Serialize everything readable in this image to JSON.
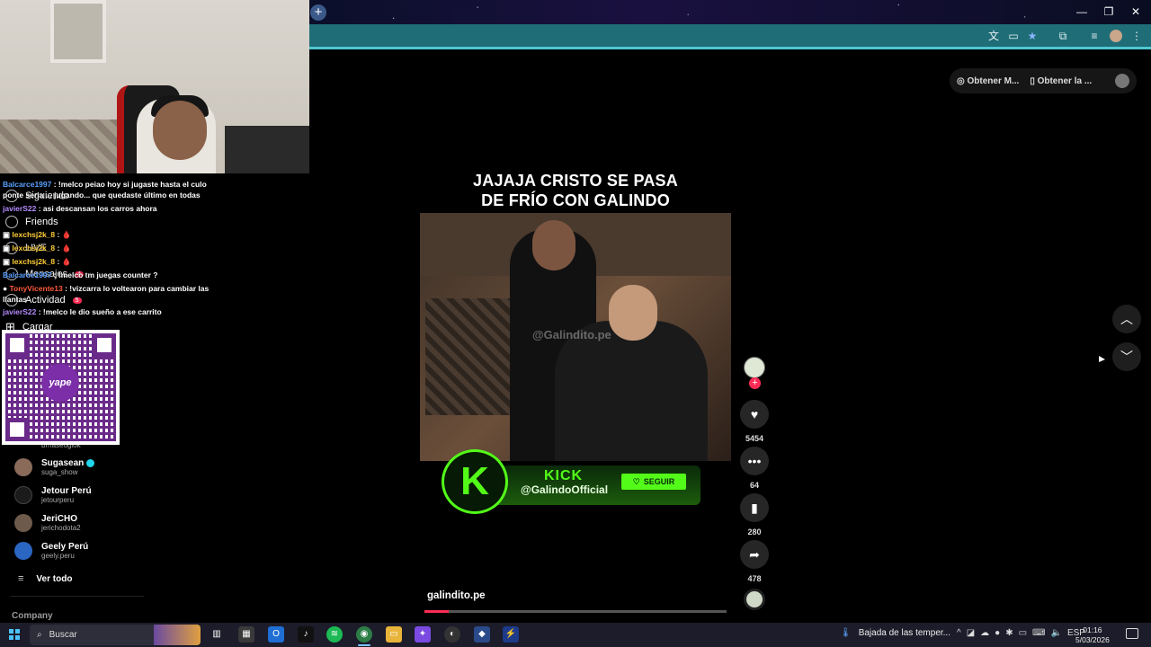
{
  "browser": {
    "pill_item_1": "Obtener M...",
    "pill_item_2": "Obtener la ..."
  },
  "sidebar": {
    "nav_following": "Siguiendo",
    "nav_friends": "Friends",
    "nav_live": "LIVE",
    "nav_messages": "Mensajes",
    "nav_activity": "Actividad",
    "nav_upload": "Cargar",
    "hidden_handle": "brnaseogiok",
    "accounts": [
      {
        "name": "Sugasean",
        "handle": "suga_show",
        "verified": true,
        "color": "#8a6b5a"
      },
      {
        "name": "Jetour Perú",
        "handle": "jetourperu",
        "verified": false,
        "color": "#1b1b1b"
      },
      {
        "name": "JeriCHO",
        "handle": "jerichodota2",
        "verified": false,
        "color": "#6e5a4a"
      },
      {
        "name": "Geely Perú",
        "handle": "geely.peru",
        "verified": false,
        "color": "#2b66c2"
      }
    ],
    "see_all": "Ver todo",
    "company": "Company",
    "messages_badge": "4",
    "activity_badge": "5"
  },
  "chat": [
    {
      "user": "Balcarce1997",
      "color": "#5aa0ff",
      "text": " : !melco peiao hoy si jugaste hasta el culo"
    },
    {
      "user": "",
      "color": "#ffffff",
      "text": "ponte seria ... jugando... que quedaste último en todas"
    },
    {
      "user": "javierS22",
      "color": "#b58cff",
      "text": " : asi descansan los carros ahora"
    },
    {
      "user": "lexchsj2k_8",
      "color": "#ffcf3a",
      "text": " : 🩸"
    },
    {
      "user": "lexchsj2k_8",
      "color": "#ffcf3a",
      "text": " : 🩸"
    },
    {
      "user": "lexchsj2k_8",
      "color": "#ffcf3a",
      "text": " : 🩸"
    },
    {
      "user": "Balcarce1997",
      "color": "#5aa0ff",
      "text": " : !melco tm juegas counter ?"
    },
    {
      "user": "TonyVicente13",
      "color": "#ff5a3a",
      "text": " : !vizcarra lo voltearon para cambiar las"
    },
    {
      "user": "",
      "color": "#ffffff",
      "text": "llantas"
    },
    {
      "user": "javierS22",
      "color": "#b58cff",
      "text": " : !melco le dio sueño a ese carrito"
    }
  ],
  "qr": {
    "brand": "yape"
  },
  "video": {
    "caption_line1": "JAJAJA CRISTO SE PASA",
    "caption_line2": "DE FRÍO CON GALINDO",
    "watermark": "@Galindito.pe",
    "kick_word": "KICK",
    "kick_handle": "@GalindoOfficial",
    "kick_follow": "SEGUIR",
    "author": "galindito.pe",
    "progress_percent": 8
  },
  "actions": {
    "likes": "5454",
    "comments": "64",
    "saves": "280",
    "shares": "478"
  },
  "taskbar": {
    "search_label": "Buscar",
    "weather": "Bajada de las temper...",
    "lang": "ESP",
    "time": "01:16",
    "date": "5/03/2026"
  }
}
